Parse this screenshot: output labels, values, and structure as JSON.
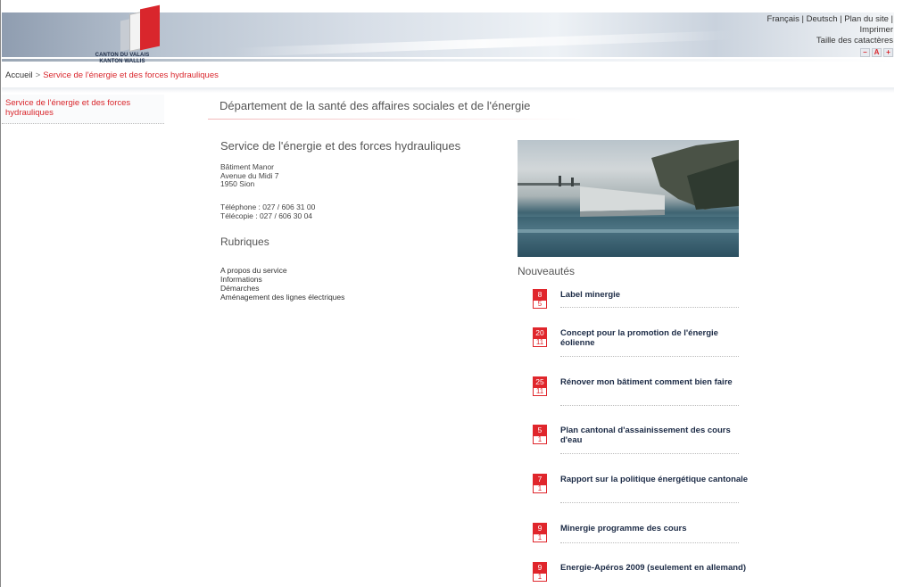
{
  "header": {
    "logo_line1": "CANTON DU VALAIS",
    "logo_line2": "KANTON WALLIS",
    "links_line1": "Français | Deutsch | Plan du site |",
    "links_line2": "Imprimer",
    "text_size_label": "Taille des catactères",
    "size_buttons": [
      "–",
      "A",
      "+"
    ]
  },
  "breadcrumb": {
    "home": "Accueil",
    "separator": ">",
    "current": "Service de l'énergie et des forces hydrauliques"
  },
  "leftnav": {
    "item": "Service de l'énergie et des forces hydrauliques"
  },
  "main": {
    "department": "Département de la santé des affaires sociales et de l'énergie",
    "service_title": "Service de l'énergie et des forces hydrauliques",
    "address": [
      "Bâtiment Manor",
      "Avenue du Midi 7",
      "1950 Sion"
    ],
    "phone": "Téléphone : 027 / 606 31 00",
    "fax": "Télécopie : 027 / 606 30 04",
    "rubriques_title": "Rubriques",
    "rubriques": [
      "A propos du service",
      "Informations",
      "Démarches",
      "Aménagement des lignes électriques"
    ]
  },
  "news": {
    "title": "Nouveautés",
    "items": [
      {
        "day": "8",
        "month": "5",
        "text": "Label minergie"
      },
      {
        "day": "20",
        "month": "11",
        "text": "Concept pour la promotion de l'énergie éolienne"
      },
      {
        "day": "25",
        "month": "11",
        "text": "Rénover mon bâtiment comment bien faire"
      },
      {
        "day": "5",
        "month": "1",
        "text": "Plan cantonal d'assainissement des cours d'eau"
      },
      {
        "day": "7",
        "month": "1",
        "text": "Rapport sur la politique énergétique cantonale"
      },
      {
        "day": "9",
        "month": "1",
        "text": "Minergie programme des cours"
      },
      {
        "day": "9",
        "month": "1",
        "text": "Energie-Apéros 2009 (seulement en allemand)"
      }
    ]
  },
  "colors": {
    "accent_red": "#d9262c",
    "headline_navy": "#1b2a45"
  }
}
